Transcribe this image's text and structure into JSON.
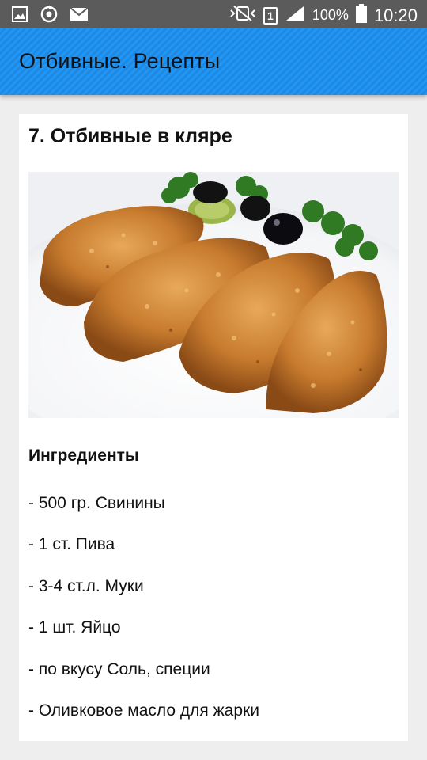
{
  "status_bar": {
    "battery_text": "100%",
    "sim_label": "1",
    "time": "10:20",
    "icons": [
      "gallery-icon",
      "sync-icon",
      "mail-icon",
      "mute-vibrate-icon",
      "sim-icon",
      "signal-icon",
      "battery-icon"
    ]
  },
  "app_bar": {
    "title": "Отбивные. Рецепты"
  },
  "recipe": {
    "title": "7. Отбивные в кляре",
    "ingredients_heading": "Ингредиенты",
    "ingredients": [
      "- 500 гр. Свинины",
      "- 1 ст. Пива",
      "- 3-4 ст.л. Муки",
      "- 1 шт. Яйцо",
      "- по вкусу Соль, специи",
      "- Оливковое масло для жарки"
    ]
  },
  "colors": {
    "status_bar": "#5b5b5b",
    "app_bar": "#2196f3",
    "background": "#eeeeee",
    "card": "#ffffff"
  }
}
